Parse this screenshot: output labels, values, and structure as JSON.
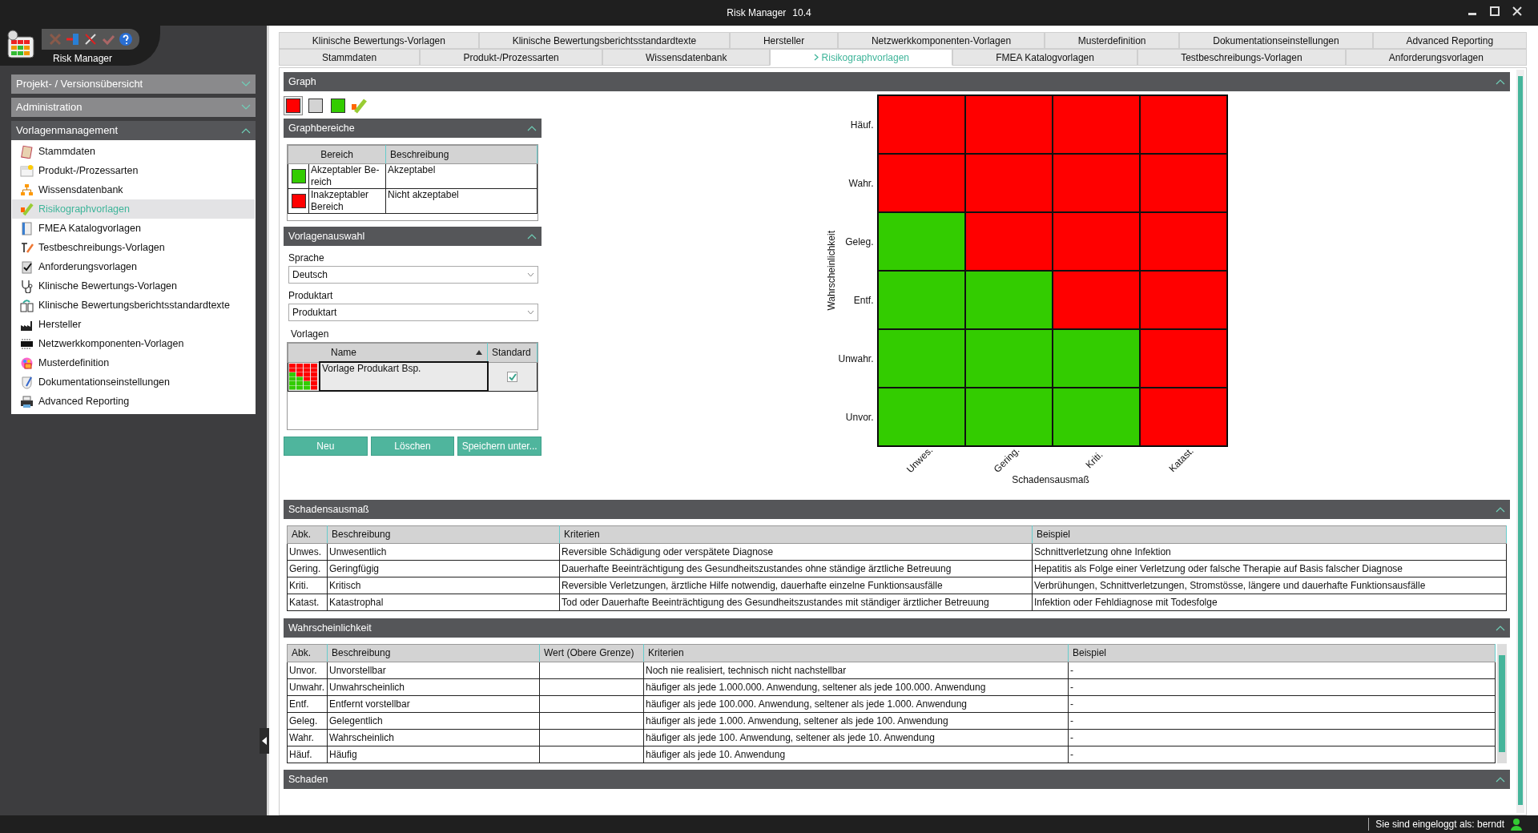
{
  "window": {
    "title": "Risk Manager",
    "version": "10.4"
  },
  "app": {
    "name": "Risk Manager"
  },
  "sidebar": {
    "sections": [
      {
        "title": "Projekt- / Versionsübersicht",
        "expanded": false
      },
      {
        "title": "Administration",
        "expanded": false
      },
      {
        "title": "Vorlagenmanagement",
        "expanded": true,
        "items": [
          {
            "label": "Stammdaten",
            "selected": false
          },
          {
            "label": "Produkt-/Prozessarten",
            "selected": false
          },
          {
            "label": "Wissensdatenbank",
            "selected": false
          },
          {
            "label": "Risikographvorlagen",
            "selected": true
          },
          {
            "label": "FMEA Katalogvorlagen",
            "selected": false
          },
          {
            "label": "Testbeschreibungs-Vorlagen",
            "selected": false
          },
          {
            "label": "Anforderungsvorlagen",
            "selected": false
          },
          {
            "label": "Klinische Bewertungs-Vorlagen",
            "selected": false
          },
          {
            "label": "Klinische Bewertungsberichtsstandardtexte",
            "selected": false
          },
          {
            "label": "Hersteller",
            "selected": false
          },
          {
            "label": "Netzwerkkomponenten-Vorlagen",
            "selected": false
          },
          {
            "label": "Musterdefinition",
            "selected": false
          },
          {
            "label": "Dokumentationseinstellungen",
            "selected": false
          },
          {
            "label": "Advanced Reporting",
            "selected": false
          }
        ]
      }
    ]
  },
  "tab_rows": [
    {
      "tabs": [
        {
          "label": "Klinische Bewertungs-Vorlagen",
          "selected": false
        },
        {
          "label": "Klinische Bewertungsberichtsstandardtexte",
          "selected": false
        },
        {
          "label": "Hersteller",
          "selected": false
        },
        {
          "label": "Netzwerkkomponenten-Vorlagen",
          "selected": false
        },
        {
          "label": "Musterdefinition",
          "selected": false
        },
        {
          "label": "Dokumentationseinstellungen",
          "selected": false
        },
        {
          "label": "Advanced Reporting",
          "selected": false
        }
      ]
    },
    {
      "tabs": [
        {
          "label": "Stammdaten",
          "selected": false
        },
        {
          "label": "Produkt-/Prozessarten",
          "selected": false
        },
        {
          "label": "Wissensdatenbank",
          "selected": false
        },
        {
          "label": "Risikographvorlagen",
          "selected": true
        },
        {
          "label": "FMEA Katalogvorlagen",
          "selected": false
        },
        {
          "label": "Testbeschreibungs-Vorlagen",
          "selected": false
        },
        {
          "label": "Anforderungsvorlagen",
          "selected": false
        }
      ]
    }
  ],
  "graph": {
    "title": "Graph",
    "expanded": true,
    "palette": [
      {
        "color": "#ff0000",
        "selected": true
      },
      {
        "color": "#d3d3d3",
        "selected": false
      },
      {
        "color": "#33cc00",
        "selected": false
      }
    ],
    "risk_graph": {
      "ylabel": "Wahrscheinlichkeit",
      "xlabel": "Schadensausmaß",
      "y_labels": [
        "Häuf.",
        "Wahr.",
        "Geleg.",
        "Entf.",
        "Unwahr.",
        "Unvor."
      ],
      "x_labels": [
        "Unwes.",
        "Gering.",
        "Kriti.",
        "Katast."
      ],
      "rows": [
        {
          "cells": [
            {
              "color": "#ff0000"
            },
            {
              "color": "#ff0000"
            },
            {
              "color": "#ff0000"
            },
            {
              "color": "#ff0000"
            }
          ]
        },
        {
          "cells": [
            {
              "color": "#ff0000"
            },
            {
              "color": "#ff0000"
            },
            {
              "color": "#ff0000"
            },
            {
              "color": "#ff0000"
            }
          ]
        },
        {
          "cells": [
            {
              "color": "#33cc00"
            },
            {
              "color": "#ff0000"
            },
            {
              "color": "#ff0000"
            },
            {
              "color": "#ff0000"
            }
          ]
        },
        {
          "cells": [
            {
              "color": "#33cc00"
            },
            {
              "color": "#33cc00"
            },
            {
              "color": "#ff0000"
            },
            {
              "color": "#ff0000"
            }
          ]
        },
        {
          "cells": [
            {
              "color": "#33cc00"
            },
            {
              "color": "#33cc00"
            },
            {
              "color": "#33cc00"
            },
            {
              "color": "#ff0000"
            }
          ]
        },
        {
          "cells": [
            {
              "color": "#33cc00"
            },
            {
              "color": "#33cc00"
            },
            {
              "color": "#33cc00"
            },
            {
              "color": "#ff0000"
            }
          ]
        }
      ]
    },
    "graphbereiche": {
      "title": "Graphbereiche",
      "expanded": true,
      "columns": [
        "Bereich",
        "Beschreibung"
      ],
      "rows": [
        {
          "color": "#33cc00",
          "bereich": "Akzeptabler Be-reich",
          "beschreibung": "Akzeptabel"
        },
        {
          "color": "#ff0000",
          "bereich": "Inakzeptabler Bereich",
          "beschreibung": "Nicht akzeptabel"
        }
      ]
    },
    "vorlagenauswahl": {
      "title": "Vorlagenauswahl",
      "expanded": true,
      "fields": [
        {
          "label": "Sprache",
          "value": "Deutsch"
        },
        {
          "label": "Produktart",
          "value": "Produktart"
        }
      ],
      "vorlagen": {
        "label": "Vorlagen",
        "columns": [
          {
            "label": "Name",
            "sorted_ascending": true
          },
          {
            "label": "Standard"
          }
        ],
        "rows": [
          {
            "name": "Vorlage Produkart Bsp.",
            "standard": true,
            "selected": true
          }
        ]
      },
      "buttons": [
        "Neu",
        "Löschen",
        "Speichern unter..."
      ]
    }
  },
  "schadensausmass": {
    "title": "Schadensausmaß",
    "expanded": true,
    "columns": [
      "Abk.",
      "Beschreibung",
      "Kriterien",
      "Beispiel"
    ],
    "rows": [
      [
        "Unwes.",
        "Unwesentlich",
        "Reversible Schädigung oder verspätete Diagnose",
        "Schnittverletzung ohne Infektion"
      ],
      [
        "Gering.",
        "Geringfügig",
        "Dauerhafte Beeinträchtigung des Gesundheitszustandes ohne ständige ärztliche Betreuung",
        "Hepatitis als Folge einer Verletzung oder falsche Therapie auf Basis falscher Diagnose"
      ],
      [
        "Kriti.",
        "Kritisch",
        "Reversible Verletzungen, ärztliche Hilfe notwendig, dauerhafte einzelne Funktionsausfälle",
        "Verbrühungen, Schnittverletzungen, Stromstösse, längere und dauerhafte Funktionsausfälle"
      ],
      [
        "Katast.",
        "Katastrophal",
        "Tod oder Dauerhafte Beeinträchtigung des Gesundheitszustandes mit ständiger ärztlicher Betreuung",
        "Infektion oder Fehldiagnose mit Todesfolge"
      ]
    ]
  },
  "wahrscheinlichkeit": {
    "title": "Wahrscheinlichkeit",
    "expanded": true,
    "columns": [
      "Abk.",
      "Beschreibung",
      "Wert (Obere Grenze)",
      "Kriterien",
      "Beispiel"
    ],
    "rows": [
      [
        "Unvor.",
        "Unvorstellbar",
        "",
        "Noch nie realisiert, technisch nicht nachstellbar",
        "-"
      ],
      [
        "Unwahr.",
        "Unwahrscheinlich",
        "",
        "häufiger als jede 1.000.000. Anwendung, seltener als jede 100.000. Anwendung",
        "-"
      ],
      [
        "Entf.",
        "Entfernt vorstellbar",
        "",
        "häufiger als jede 100.000. Anwendung, seltener als jede 1.000. Anwendung",
        "-"
      ],
      [
        "Geleg.",
        "Gelegentlich",
        "",
        "häufiger als jede 1.000. Anwendung, seltener als jede 100. Anwendung",
        "-"
      ],
      [
        "Wahr.",
        "Wahrscheinlich",
        "",
        "häufiger als jede 100. Anwendung, seltener als jede 10. Anwendung",
        "-"
      ],
      [
        "Häuf.",
        "Häufig",
        "",
        "häufiger als jede 10. Anwendung",
        "-"
      ]
    ]
  },
  "schaden": {
    "title": "Schaden",
    "expanded": true
  },
  "status_bar": {
    "text": "Sie sind eingeloggt als: berndt"
  }
}
